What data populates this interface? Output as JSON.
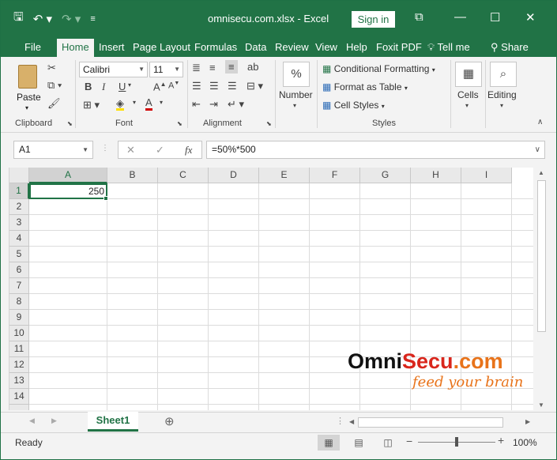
{
  "window": {
    "title": "omnisecu.com.xlsx  -  Excel",
    "sign_in": "Sign in"
  },
  "tabs": [
    "File",
    "Home",
    "Insert",
    "Page Layout",
    "Formulas",
    "Data",
    "Review",
    "View",
    "Help",
    "Foxit PDF",
    "Tell me",
    "Share"
  ],
  "active_tab": "Home",
  "ribbon": {
    "clipboard": {
      "paste": "Paste",
      "label": "Clipboard"
    },
    "font": {
      "name": "Calibri",
      "size": "11",
      "bold": "B",
      "italic": "I",
      "underline": "U",
      "font_color": "A",
      "label": "Font"
    },
    "alignment": {
      "label": "Alignment"
    },
    "number": {
      "symbol": "%",
      "label": "Number"
    },
    "styles": {
      "conditional_formatting": "Conditional Formatting",
      "format_as_table": "Format as Table",
      "cell_styles": "Cell Styles",
      "label": "Styles"
    },
    "cells": {
      "label": "Cells"
    },
    "editing": {
      "label": "Editing"
    }
  },
  "formula_bar": {
    "name_box": "A1",
    "cancel": "✕",
    "enter": "✓",
    "fx": "fx",
    "formula": "=50%*500"
  },
  "grid": {
    "columns": [
      "A",
      "B",
      "C",
      "D",
      "E",
      "F",
      "G",
      "H",
      "I"
    ],
    "rows": [
      "1",
      "2",
      "3",
      "4",
      "5",
      "6",
      "7",
      "8",
      "9",
      "10",
      "11",
      "12",
      "13",
      "14"
    ],
    "selected_cell": "A1",
    "cells": {
      "A1": "250"
    }
  },
  "watermark": {
    "omni": "Omni",
    "secu": "Secu",
    "com": ".com",
    "tagline": "feed your brain"
  },
  "sheets": [
    "Sheet1"
  ],
  "status": {
    "ready": "Ready",
    "zoom": "100%"
  },
  "colors": {
    "excel_green": "#217346",
    "watermark_red": "#d9261c",
    "watermark_orange": "#e8731a"
  }
}
